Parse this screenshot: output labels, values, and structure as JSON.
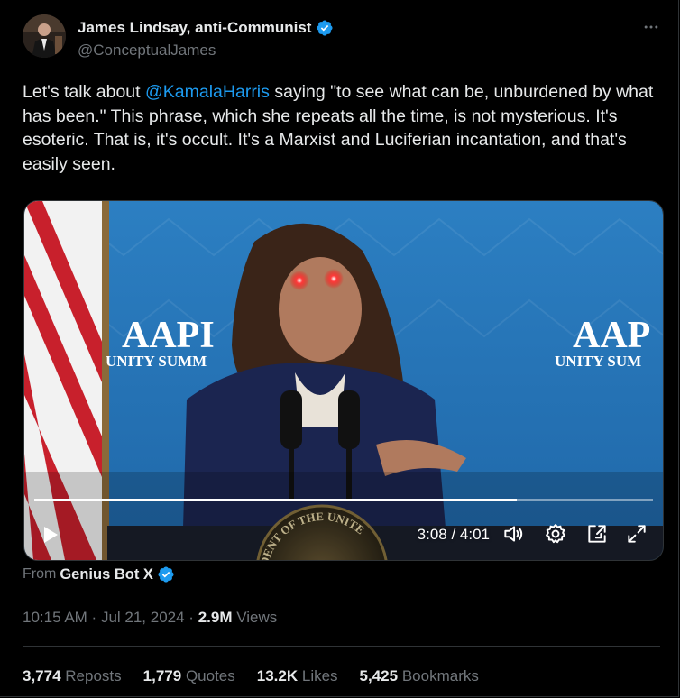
{
  "author": {
    "name": "James Lindsay, anti-Communist",
    "handle": "@ConceptualJames"
  },
  "post": {
    "text_before": "Let's talk about ",
    "mention": "@KamalaHarris",
    "text_after": " saying \"to see what can be, unburdened by what has been.\" This phrase, which she repeats all the time, is not mysterious. It's esoteric. That is, it's occult. It's a Marxist and Luciferian incantation, and that's easily seen."
  },
  "video": {
    "backdrop_left_big": "AAPI",
    "backdrop_left_small": "UNITY SUMM",
    "backdrop_right_big": "AAP",
    "backdrop_right_small": "UNITY SUM",
    "seal_text": "DENT OF THE UNITE",
    "time": "3:08 / 4:01",
    "progress": 0.78
  },
  "source": {
    "prefix": "From",
    "name": "Genius Bot X"
  },
  "meta": {
    "time": "10:15 AM",
    "sep": " · ",
    "date": "Jul 21, 2024",
    "views": "2.9M",
    "views_label": "Views"
  },
  "stats": {
    "reposts": "3,774",
    "reposts_label": "Reposts",
    "quotes": "1,779",
    "quotes_label": "Quotes",
    "likes": "13.2K",
    "likes_label": "Likes",
    "bookmarks": "5,425",
    "bookmarks_label": "Bookmarks"
  },
  "colors": {
    "accent": "#1d9bf0",
    "background": "#000000",
    "text": "#e7e9ea",
    "muted": "#71767b"
  },
  "icons": [
    "verified-badge-icon",
    "more-icon",
    "play-icon",
    "volume-icon",
    "settings-icon",
    "pip-icon",
    "fullscreen-icon"
  ]
}
